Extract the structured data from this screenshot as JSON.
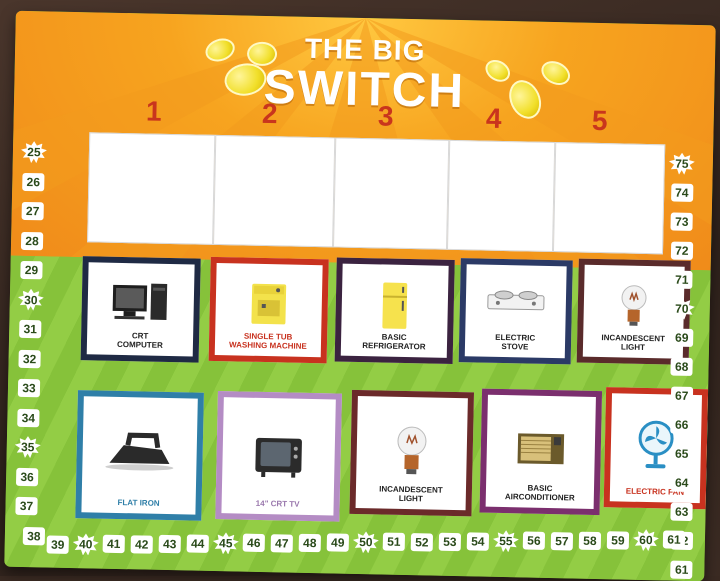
{
  "board": {
    "title_small": "THE BIG",
    "title_big": "SWITCH",
    "columns": [
      "1",
      "2",
      "3",
      "4",
      "5"
    ],
    "left_track": [
      "25",
      "26",
      "27",
      "28",
      "29",
      "30",
      "31",
      "32",
      "33",
      "34",
      "35",
      "36",
      "37",
      "38"
    ],
    "right_track": [
      "75",
      "74",
      "73",
      "72",
      "71",
      "70",
      "69",
      "68",
      "67",
      "66",
      "65",
      "64",
      "63",
      "62",
      "61"
    ],
    "bottom_track": [
      "39",
      "40",
      "41",
      "42",
      "43",
      "44",
      "45",
      "46",
      "47",
      "48",
      "49",
      "50",
      "51",
      "52",
      "53",
      "54",
      "55",
      "56",
      "57",
      "58",
      "59",
      "60",
      "61"
    ],
    "cards_row1": [
      {
        "label": "CRT\nCOMPUTER",
        "border": "#1f2a44",
        "icon": "computer-icon"
      },
      {
        "label": "SINGLE TUB\nWASHING MACHINE",
        "border": "#c8321f",
        "icon": "washing-machine-icon",
        "text_color": "#c8321f"
      },
      {
        "label": "BASIC\nREFRIGERATOR",
        "border": "#3b2340",
        "icon": "refrigerator-icon"
      },
      {
        "label": "ELECTRIC\nSTOVE",
        "border": "#2b3a66",
        "icon": "stove-icon"
      },
      {
        "label": "INCANDESCENT\nLIGHT",
        "border": "#5a2b2b",
        "icon": "light-bulb-icon"
      }
    ],
    "cards_row2": [
      {
        "label": "FLAT IRON",
        "border": "#2f7fa8",
        "icon": "flat-iron-icon",
        "text_color": "#2f7fa8"
      },
      {
        "label": "14\" CRT TV",
        "border": "#b48cc4",
        "icon": "tv-icon",
        "text_color": "#9a78ad"
      },
      {
        "label": "INCANDESCENT\nLIGHT",
        "border": "#6b2a2a",
        "icon": "light-bulb-icon"
      },
      {
        "label": "BASIC\nAIRCONDITIONER",
        "border": "#7b2f6e",
        "icon": "air-conditioner-icon"
      },
      {
        "label": "ELECTRIC FAN",
        "border": "#c8321f",
        "icon": "electric-fan-icon",
        "text_color": "#c8321f"
      }
    ],
    "colors": {
      "orange": "#f7a41f",
      "green": "#8cc63f",
      "number_red": "#c9351d"
    }
  }
}
